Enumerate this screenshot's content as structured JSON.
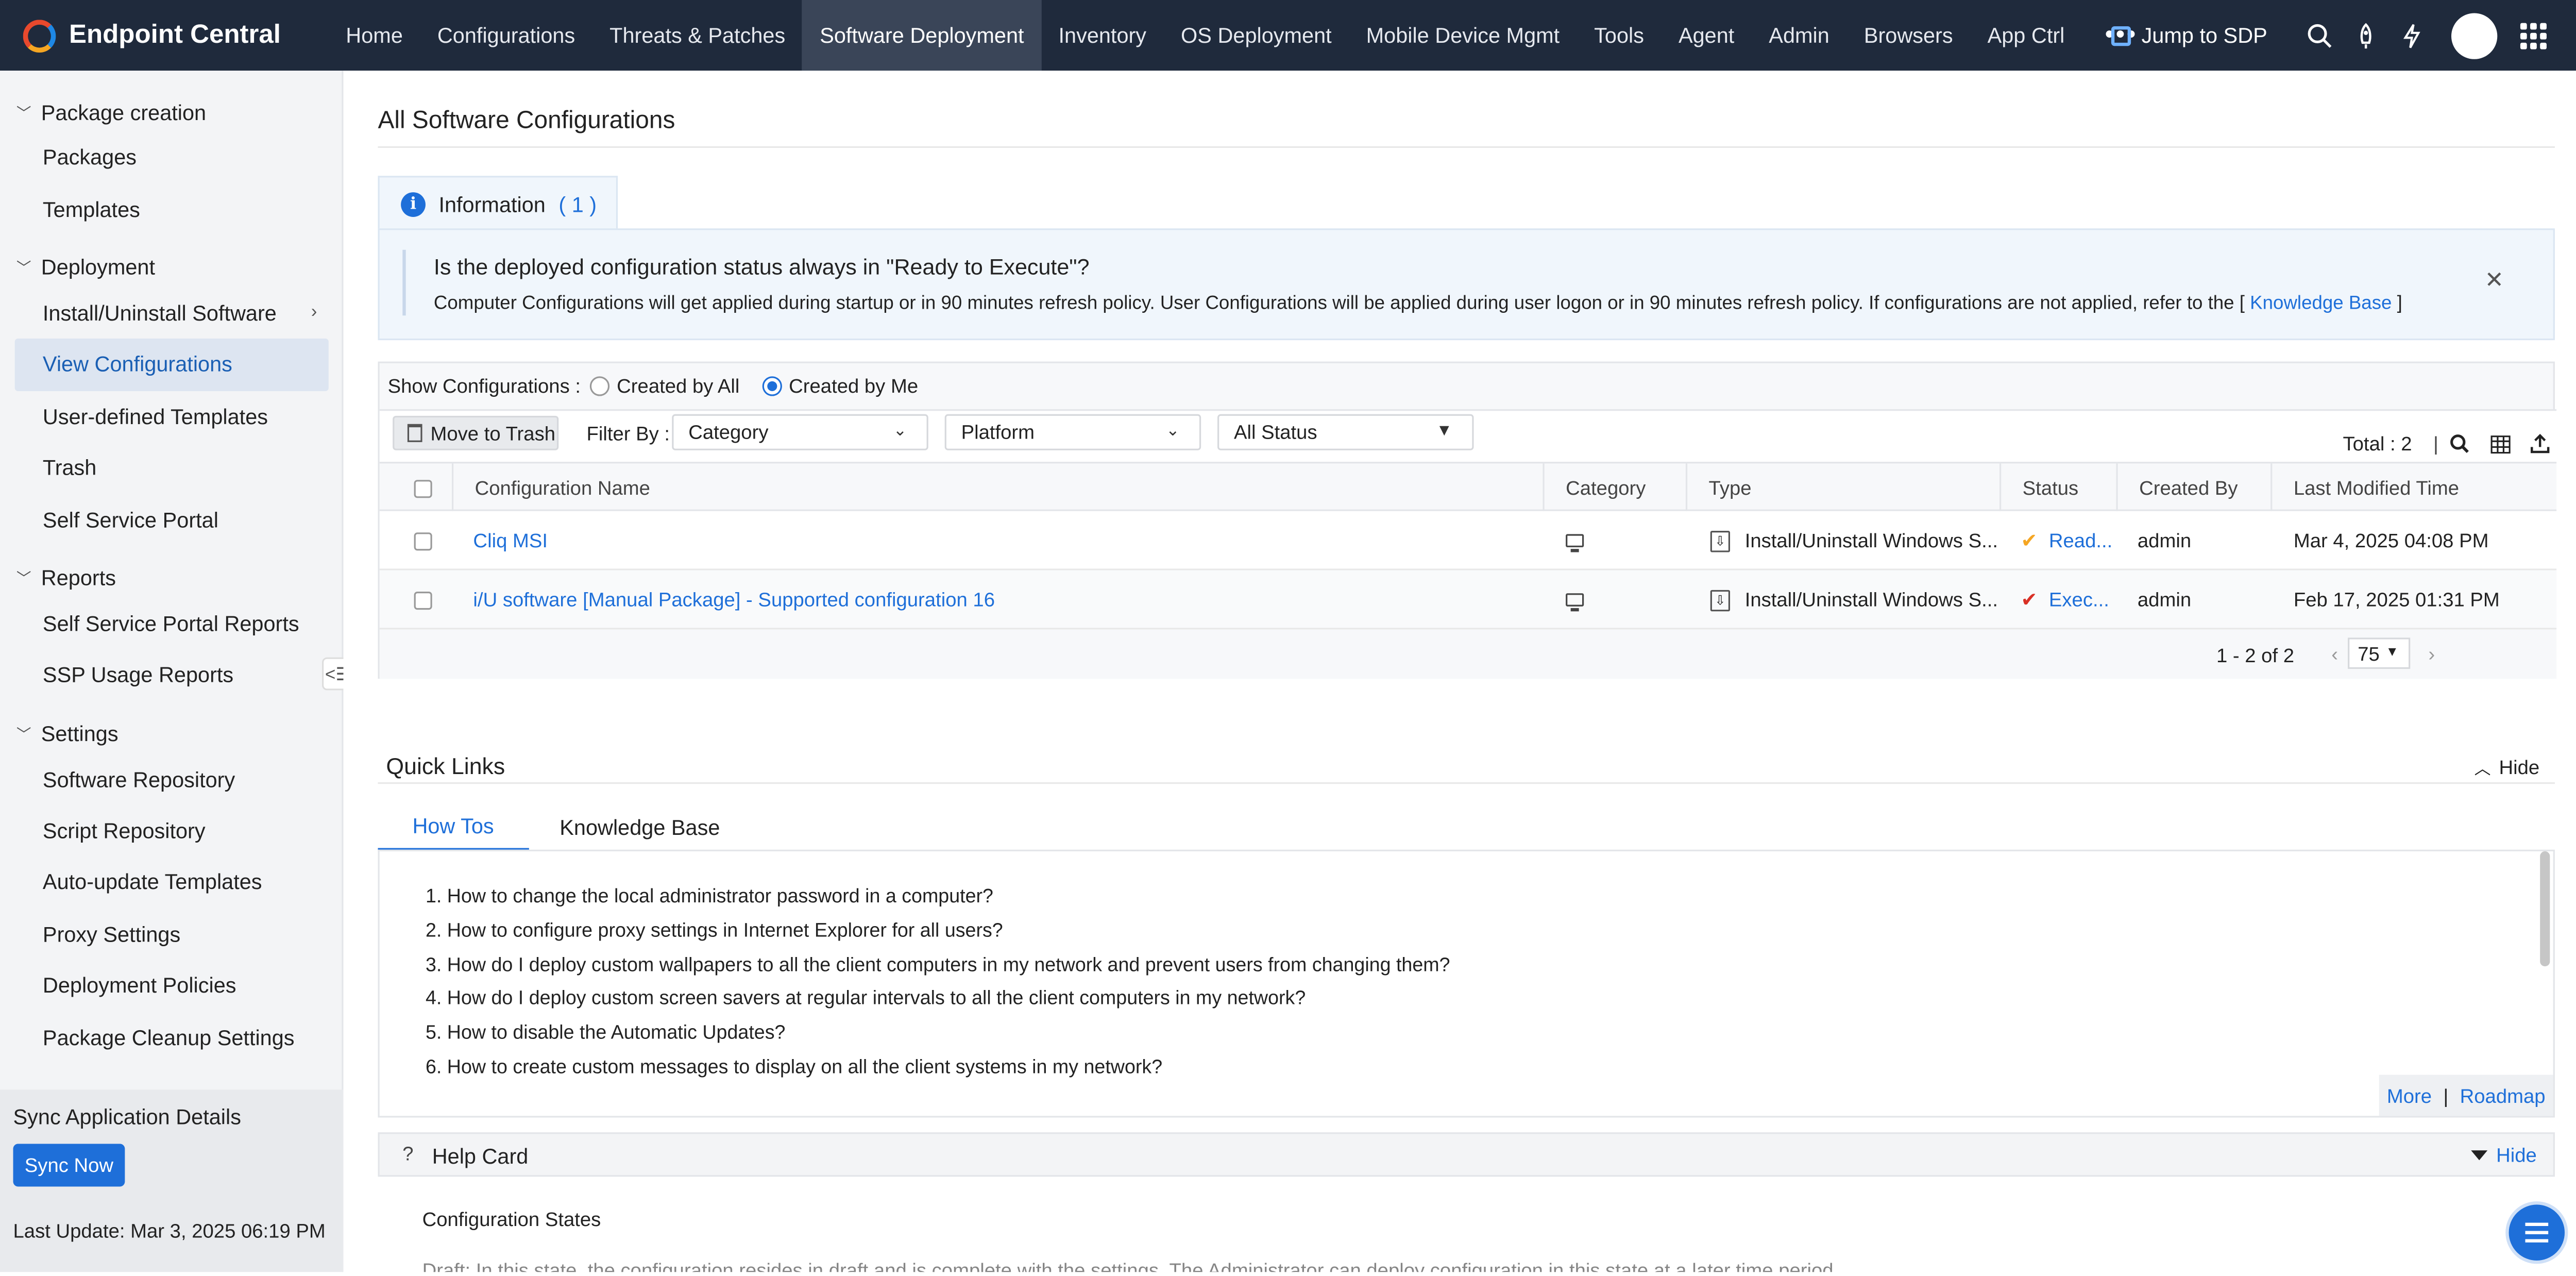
{
  "app": {
    "brand": "Endpoint Central",
    "nav": [
      "Home",
      "Configurations",
      "Threats & Patches",
      "Software Deployment",
      "Inventory",
      "OS Deployment",
      "Mobile Device Mgmt",
      "Tools",
      "Agent",
      "Admin",
      "Browsers",
      "App Ctrl"
    ],
    "nav_active": "Software Deployment",
    "more": "•••",
    "jump": "Jump to SDP"
  },
  "sidebar": {
    "groups": [
      {
        "label": "Package creation",
        "items": [
          "Packages",
          "Templates"
        ]
      },
      {
        "label": "Deployment",
        "items": [
          "Install/Uninstall Software",
          "View Configurations",
          "User-defined Templates",
          "Trash",
          "Self Service Portal"
        ]
      },
      {
        "label": "Reports",
        "items": [
          "Self Service Portal Reports",
          "SSP Usage Reports"
        ]
      },
      {
        "label": "Settings",
        "items": [
          "Software Repository",
          "Script Repository",
          "Auto-update Templates",
          "Proxy Settings",
          "Deployment Policies",
          "Package Cleanup Settings"
        ]
      }
    ],
    "active_item": "View Configurations",
    "sync_title": "Sync Application Details",
    "sync_button": "Sync Now",
    "last_update": "Last Update: Mar 3, 2025 06:19 PM"
  },
  "main": {
    "title": "All Software Configurations",
    "info": {
      "tab_label": "Information",
      "tab_count": "( 1 )",
      "question": "Is the deployed configuration status always in \"Ready to Execute\"?",
      "description": "Computer Configurations will get applied during startup or in 90 minutes refresh policy. User Configurations will be applied during user logon or in 90 minutes refresh policy. If configurations are not applied, refer to the [",
      "link": "Knowledge Base",
      "description_end": "]"
    },
    "show_configs": {
      "label": "Show Configurations :",
      "options": [
        "Created by All",
        "Created by Me"
      ],
      "selected": "Created by Me"
    },
    "toolbar": {
      "move_to_trash": "Move to Trash",
      "filter_by": "Filter By :",
      "category_placeholder": "Category",
      "platform_placeholder": "Platform",
      "status_value": "All Status",
      "total": "Total : 2"
    },
    "table": {
      "columns": [
        "Configuration Name",
        "Category",
        "Type",
        "Status",
        "Created By",
        "Last Modified Time"
      ],
      "rows": [
        {
          "name": "Cliq MSI",
          "category": "computer-icon",
          "type": "Install/Uninstall Windows S...",
          "status": "Read...",
          "status_color": "#f5a623",
          "created_by": "admin",
          "modified": "Mar 4, 2025 04:08 PM"
        },
        {
          "name": "i/U software [Manual Package] - Supported configuration 16",
          "category": "computer-icon",
          "type": "Install/Uninstall Windows S...",
          "status": "Exec...",
          "status_color": "#d93025",
          "created_by": "admin",
          "modified": "Feb 17, 2025 01:31 PM"
        }
      ]
    },
    "pager": {
      "range": "1 - 2 of 2",
      "page_size": "75"
    },
    "quick_links": {
      "title": "Quick Links",
      "hide": "Hide",
      "tabs": [
        "How Tos",
        "Knowledge Base"
      ],
      "active_tab": "How Tos",
      "items": [
        "1. How to change the local administrator password in a computer?",
        "2. How to configure proxy settings in Internet Explorer for all users?",
        "3. How do I deploy custom wallpapers to all the client computers in my network and prevent users from changing them?",
        "4. How do I deploy custom screen savers at regular intervals to all the client computers in my network?",
        "5. How to disable the Automatic Updates?",
        "6. How to create custom messages to display on all the client systems in my network?"
      ],
      "more": "More",
      "separator": "|",
      "roadmap": "Roadmap"
    },
    "help_card": {
      "title": "Help Card",
      "hide": "Hide",
      "subtitle": "Configuration States",
      "cut_text": "Draft: In this state, the configuration resides in draft and is complete with the settings. The Administrator can deploy configuration in this state at a later time period."
    }
  },
  "colors": {
    "accent": "#1e6fd9",
    "topbar": "#1f2a3c"
  }
}
